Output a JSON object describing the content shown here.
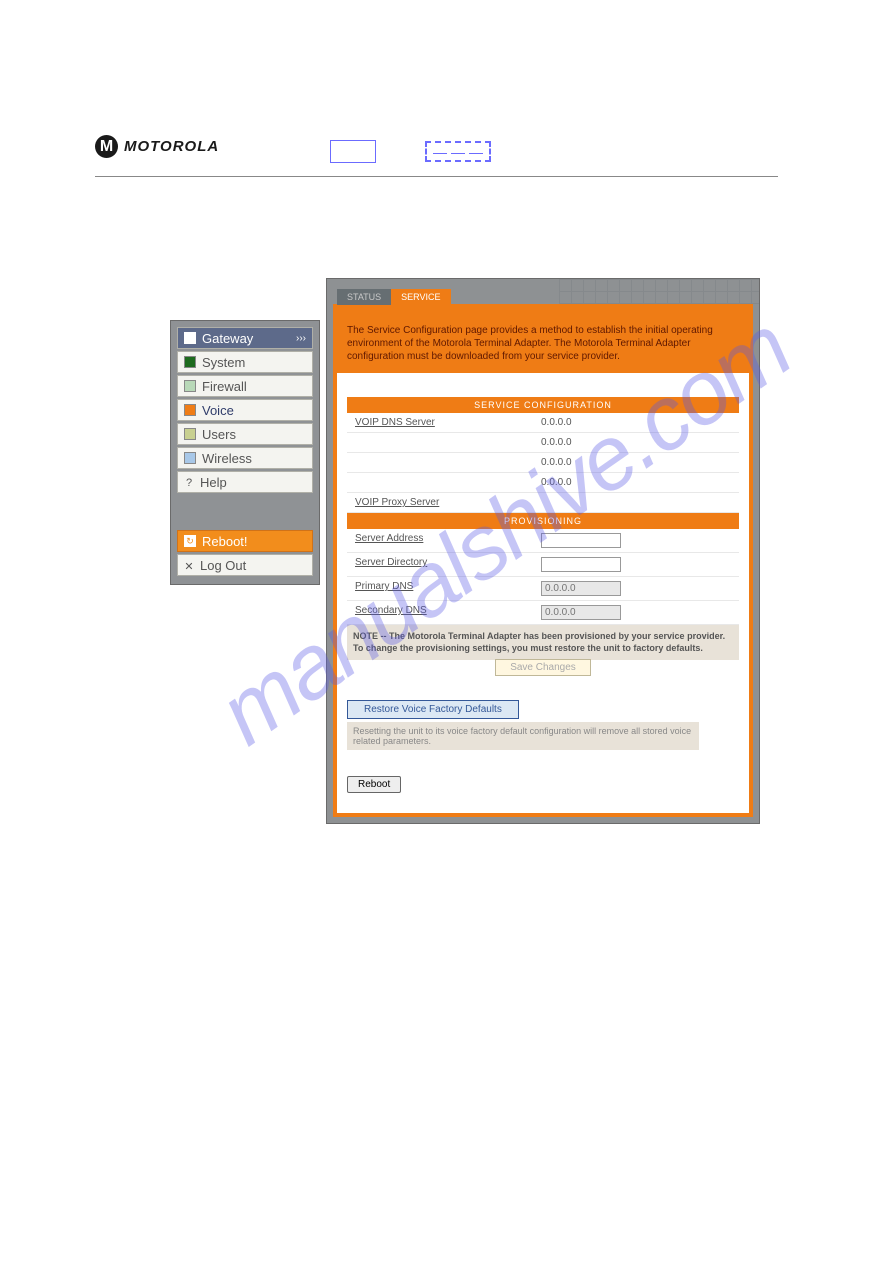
{
  "brand": "MOTOROLA",
  "watermark": "manualshive.com",
  "sidebar": {
    "gateway": "Gateway",
    "system": "System",
    "firewall": "Firewall",
    "voice": "Voice",
    "users": "Users",
    "wireless": "Wireless",
    "help": "Help",
    "reboot": "Reboot!",
    "logout": "Log Out"
  },
  "tabs": {
    "status": "STATUS",
    "service": "SERVICE"
  },
  "desc": "The Service Configuration page provides a method to establish the initial operating environment of the Motorola Terminal Adapter. The Motorola Terminal Adapter configuration must be downloaded from your service provider.",
  "sections": {
    "service_config": "SERVICE CONFIGURATION",
    "provisioning": "PROVISIONING"
  },
  "fields": {
    "voip_dns": "VOIP DNS Server",
    "voip_proxy": "VOIP Proxy Server",
    "server_addr": "Server Address",
    "server_dir": "Server Directory",
    "primary_dns": "Primary DNS",
    "secondary_dns": "Secondary DNS"
  },
  "values": {
    "dns1": "0.0.0.0",
    "dns2": "0.0.0.0",
    "dns3": "0.0.0.0",
    "dns4": "0.0.0.0",
    "primary_dns_placeholder": "0.0.0.0",
    "secondary_dns_placeholder": "0.0.0.0"
  },
  "note": "NOTE -- The Motorola Terminal Adapter has been provisioned by your service provider. To change the provisioning settings, you must restore the unit to factory defaults.",
  "buttons": {
    "save": "Save Changes",
    "restore": "Restore Voice Factory Defaults",
    "reboot_small": "Reboot"
  },
  "reset_msg": "Resetting the unit to its voice factory default configuration will remove all stored voice related parameters."
}
